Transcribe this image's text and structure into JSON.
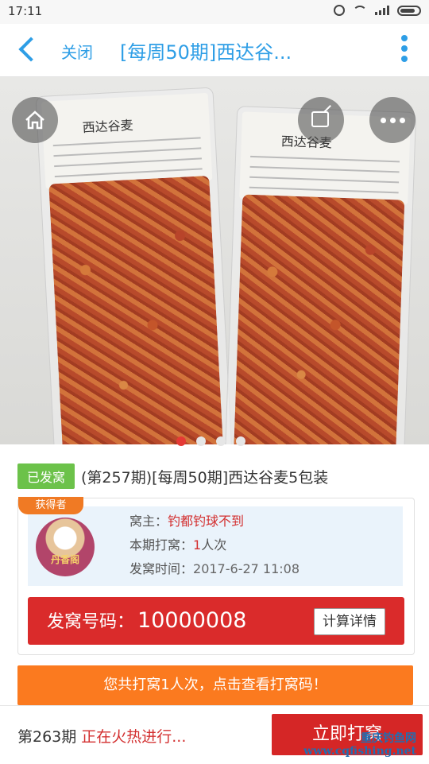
{
  "status_bar": {
    "time": "17:11"
  },
  "header": {
    "close_label": "关闭",
    "title": "[每周50期]西达谷..."
  },
  "gallery": {
    "bag_label": "西达谷麦",
    "pages": 4,
    "active_page": 1
  },
  "product": {
    "status": "已发窝",
    "title": "(第257期)[每周50期]西达谷麦5包装"
  },
  "winner": {
    "tag": "获得者",
    "avatar_text": "丹香阁",
    "owner_label": "窝主：",
    "owner_value": "钓都钓球不到",
    "count_label": "本期打窝：",
    "count_value": "1",
    "count_unit": "人次",
    "time_label": "发窝时间：",
    "time_value": "2017-6-27 11:08",
    "code_label": "发窝号码：",
    "code_value": "10000008",
    "detail_button": "计算详情"
  },
  "banner": {
    "text": "您共打窝1人次，点击查看打窝码！"
  },
  "footer": {
    "period": "第263期",
    "status": "正在火热进行...",
    "button": "立即打窝",
    "watermark_cn": "重庆钓鱼网",
    "watermark_url": "www.cqfishing.net"
  },
  "colors": {
    "accent": "#2e9ee6",
    "red": "#d52626",
    "orange": "#fb7a1f",
    "green": "#6cc24a"
  }
}
